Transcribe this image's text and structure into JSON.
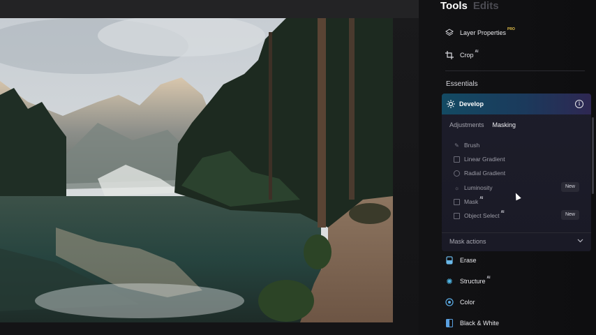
{
  "panel": {
    "tabs": [
      {
        "label": "Tools",
        "active": true
      },
      {
        "label": "Edits",
        "active": false
      }
    ],
    "top_tools": [
      {
        "label": "Layer Properties",
        "tag": "PRO",
        "icon": "layers-icon"
      },
      {
        "label": "Crop",
        "tag": "AI",
        "icon": "crop-icon"
      }
    ],
    "section_title": "Essentials",
    "develop": {
      "title": "Develop",
      "sub_tabs": [
        {
          "label": "Adjustments",
          "active": false
        },
        {
          "label": "Masking",
          "active": true
        }
      ],
      "mask_items": [
        {
          "label": "Brush",
          "icon": "brush-icon",
          "badge": ""
        },
        {
          "label": "Linear Gradient",
          "icon": "linear-gradient-icon",
          "badge": ""
        },
        {
          "label": "Radial Gradient",
          "icon": "radial-gradient-icon",
          "badge": ""
        },
        {
          "label": "Luminosity",
          "icon": "luminosity-icon",
          "badge": "New"
        },
        {
          "label": "Mask",
          "icon": "mask-ai-icon",
          "tag": "AI",
          "badge": ""
        },
        {
          "label": "Object Select",
          "icon": "object-select-icon",
          "tag": "AI",
          "badge": "New"
        }
      ],
      "mask_actions_label": "Mask actions"
    },
    "bottom_tools": [
      {
        "label": "Erase",
        "icon": "erase-icon"
      },
      {
        "label": "Structure",
        "tag": "AI",
        "icon": "structure-icon"
      },
      {
        "label": "Color",
        "icon": "color-icon"
      },
      {
        "label": "Black & White",
        "icon": "black-white-icon"
      }
    ]
  },
  "colors": {
    "accent_blue": "#134a63",
    "accent_purple": "#2e2752",
    "pro_gold": "#e6c24a"
  }
}
